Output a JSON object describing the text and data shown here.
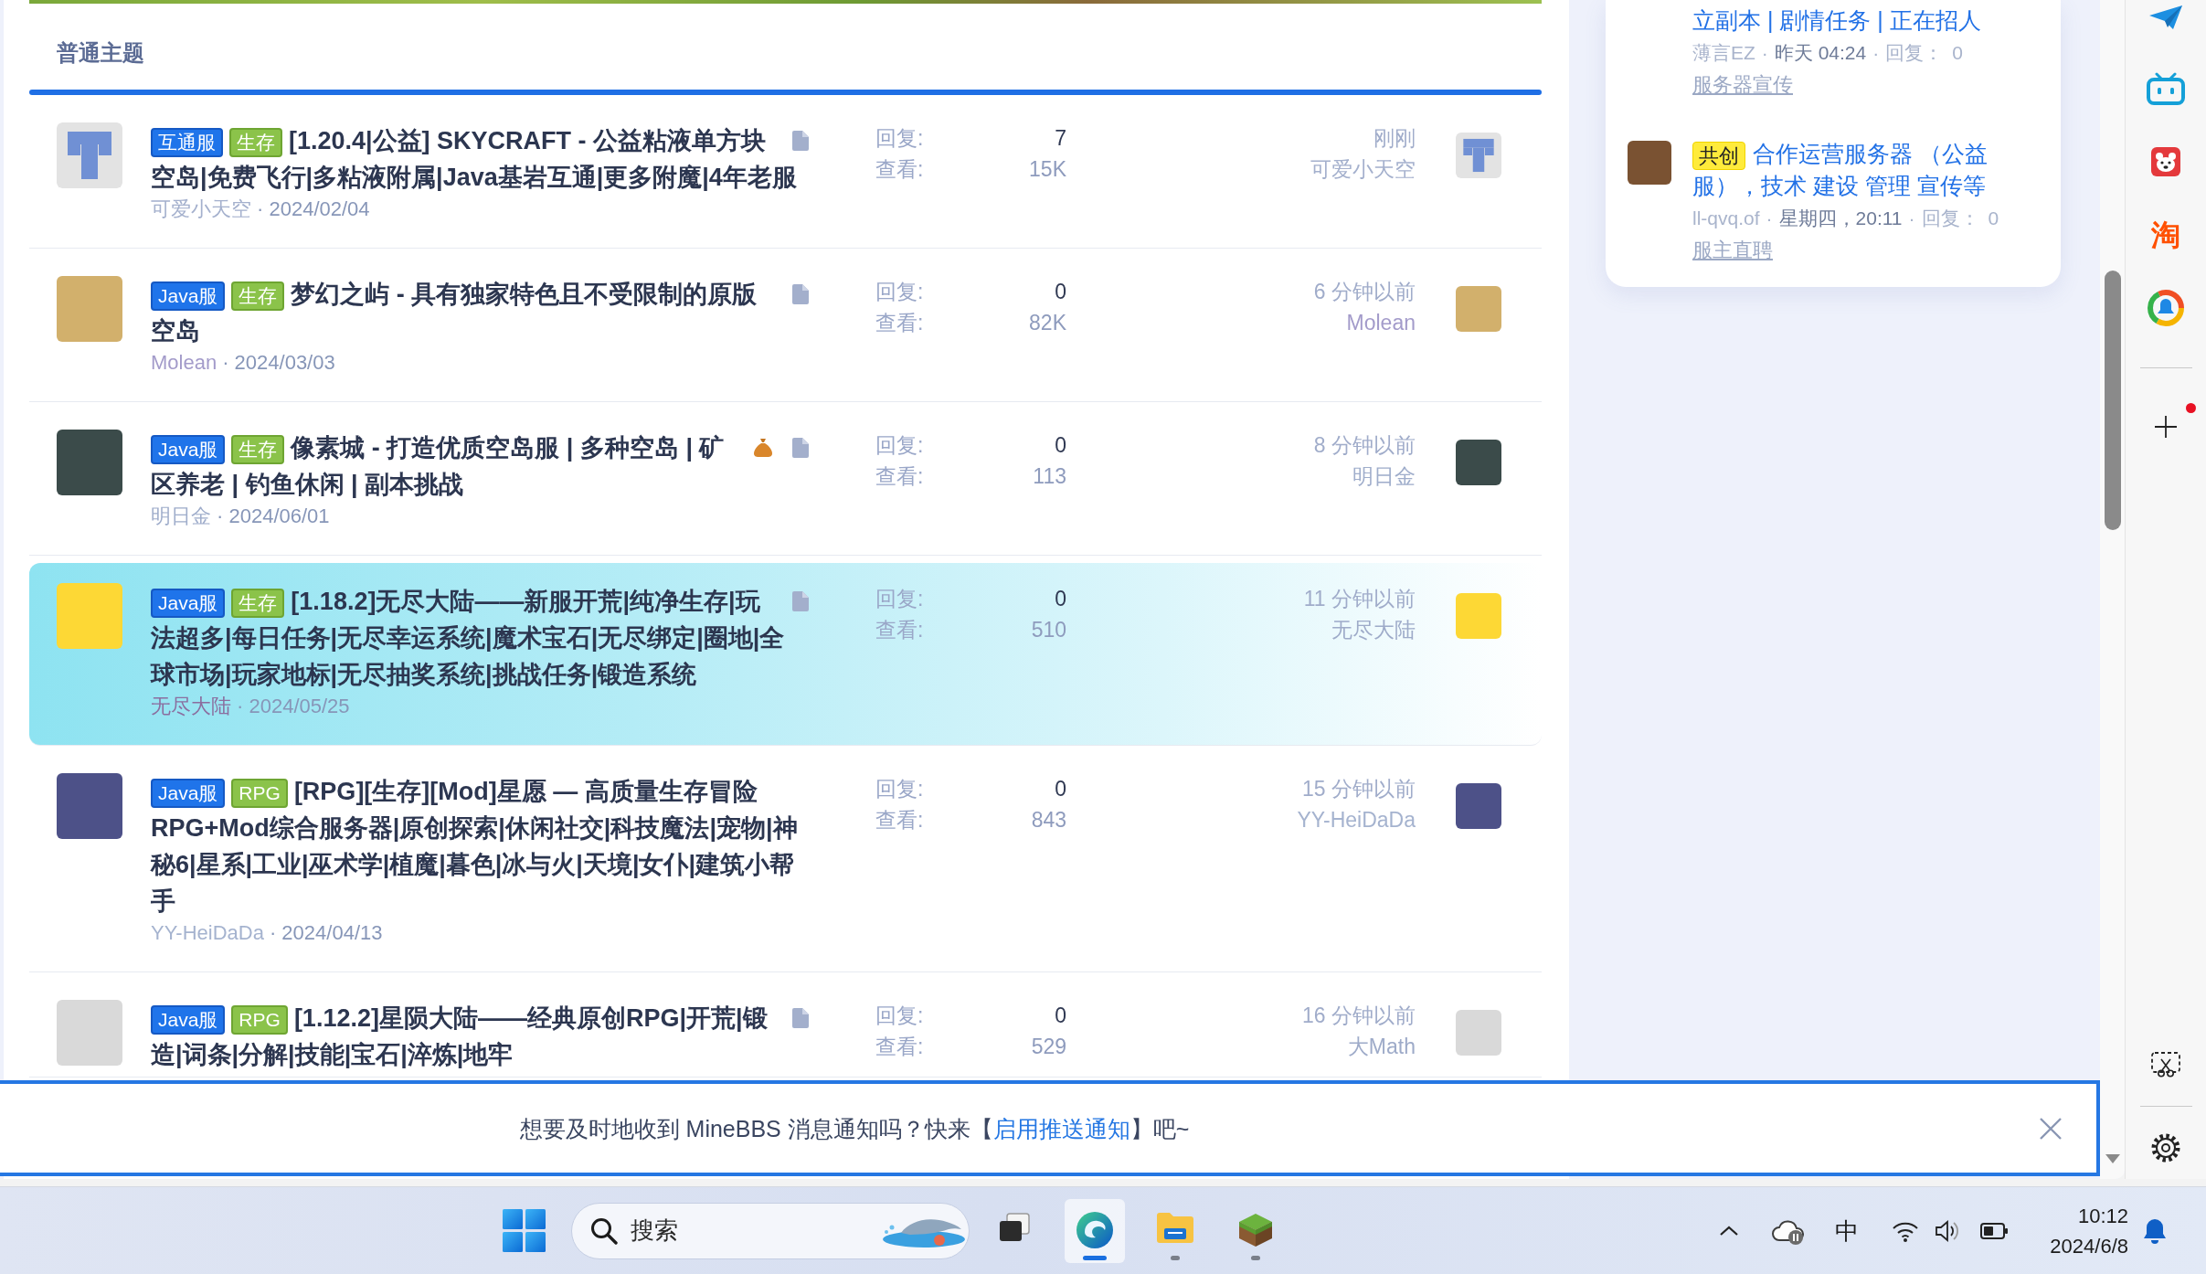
{
  "forum": {
    "section_title": "普通主题",
    "threads": [
      {
        "highlighted": false,
        "avatar": {
          "kind": "pattern",
          "color": "#7090d4"
        },
        "tags": [
          {
            "label": "互通服",
            "kind": "platform"
          },
          {
            "label": "生存",
            "kind": "genre"
          }
        ],
        "title": "[1.20.4|公益] SKYCRAFT - 公益粘液单方块空岛|免费飞行|多粘液附属|Java基岩互通|更多附魔|4年老服",
        "reward": false,
        "attachment": true,
        "author": {
          "name": "可爱小天空",
          "color": "#a4b0cd"
        },
        "date": "· 2024/02/04",
        "stats": [
          {
            "kind": "replies",
            "label": "回复:",
            "value": "7"
          },
          {
            "kind": "views",
            "label": "查看:",
            "value": "15K"
          }
        ],
        "last_post": {
          "time": "刚刚",
          "user": {
            "name": "可爱小天空",
            "color": "#a4b0cd"
          },
          "avatar": {
            "kind": "pattern",
            "color": "#7090d4"
          }
        }
      },
      {
        "highlighted": false,
        "avatar": {
          "kind": "image",
          "color": "#d2b06c"
        },
        "tags": [
          {
            "label": "Java服",
            "kind": "platform"
          },
          {
            "label": "生存",
            "kind": "genre"
          }
        ],
        "title": "梦幻之屿 - 具有独家特色且不受限制的原版空岛",
        "reward": false,
        "attachment": true,
        "author": {
          "name": "Molean",
          "color": "#a39bca"
        },
        "date": "· 2024/03/03",
        "stats": [
          {
            "kind": "replies",
            "label": "回复:",
            "value": "0"
          },
          {
            "kind": "views",
            "label": "查看:",
            "value": "82K"
          }
        ],
        "last_post": {
          "time": "6 分钟以前",
          "user": {
            "name": "Molean",
            "color": "#a39bca"
          },
          "avatar": {
            "kind": "image",
            "color": "#d2b06c"
          }
        }
      },
      {
        "highlighted": false,
        "avatar": {
          "kind": "image",
          "color": "#3b4b4a"
        },
        "tags": [
          {
            "label": "Java服",
            "kind": "platform"
          },
          {
            "label": "生存",
            "kind": "genre"
          }
        ],
        "title": "像素城 - 打造优质空岛服 | 多种空岛 | 矿区养老 | 钓鱼休闲 | 副本挑战",
        "reward": true,
        "attachment": true,
        "author": {
          "name": "明日金",
          "color": "#9fadcb"
        },
        "date": "· 2024/06/01",
        "stats": [
          {
            "kind": "replies",
            "label": "回复:",
            "value": "0"
          },
          {
            "kind": "views",
            "label": "查看:",
            "value": "113"
          }
        ],
        "last_post": {
          "time": "8 分钟以前",
          "user": {
            "name": "明日金",
            "color": "#9fadcb"
          },
          "avatar": {
            "kind": "image",
            "color": "#3b4b4a"
          }
        }
      },
      {
        "highlighted": true,
        "avatar": {
          "kind": "image",
          "color": "#fdd835"
        },
        "tags": [
          {
            "label": "Java服",
            "kind": "platform"
          },
          {
            "label": "生存",
            "kind": "genre"
          }
        ],
        "title": "[1.18.2]无尽大陆——新服开荒|纯净生存|玩法超多|每日任务|无尽幸运系统|魔术宝石|无尽绑定|圈地|全球市场|玩家地标|无尽抽奖系统|挑战任务|锻造系统",
        "reward": false,
        "attachment": true,
        "author": {
          "name": "无尽大陆",
          "color": "#8b6e9f"
        },
        "date": "· 2024/05/25",
        "stats": [
          {
            "kind": "replies",
            "label": "回复:",
            "value": "0"
          },
          {
            "kind": "views",
            "label": "查看:",
            "value": "510"
          }
        ],
        "last_post": {
          "time": "11 分钟以前",
          "user": {
            "name": "无尽大陆",
            "color": "#9eabc9"
          },
          "avatar": {
            "kind": "image",
            "color": "#fdd835"
          }
        }
      },
      {
        "highlighted": false,
        "avatar": {
          "kind": "image",
          "color": "#4d5188"
        },
        "tags": [
          {
            "label": "Java服",
            "kind": "platform"
          },
          {
            "label": "RPG",
            "kind": "genre"
          }
        ],
        "title": "[RPG][生存][Mod]星愿 — 高质量生存冒险RPG+Mod综合服务器|原创探索|休闲社交|科技魔法|宠物|神秘6|星系|工业|巫术学|植魔|暮色|冰与火|天境|女仆|建筑小帮手",
        "reward": false,
        "attachment": false,
        "author": {
          "name": "YY-HeiDaDa",
          "color": "#a5b3cf"
        },
        "date": "· 2024/04/13",
        "stats": [
          {
            "kind": "replies",
            "label": "回复:",
            "value": "0"
          },
          {
            "kind": "views",
            "label": "查看:",
            "value": "843"
          }
        ],
        "last_post": {
          "time": "15 分钟以前",
          "user": {
            "name": "YY-HeiDaDa",
            "color": "#a5b3cf"
          },
          "avatar": {
            "kind": "image",
            "color": "#4d5188"
          }
        }
      },
      {
        "highlighted": false,
        "avatar": {
          "kind": "image",
          "color": "#d9d9d9"
        },
        "tags": [
          {
            "label": "Java服",
            "kind": "platform"
          },
          {
            "label": "RPG",
            "kind": "genre"
          }
        ],
        "title": "[1.12.2]星陨大陆——经典原创RPG|开荒|锻造|词条|分解|技能|宝石|淬炼|地牢",
        "reward": false,
        "attachment": true,
        "stats": [
          {
            "kind": "replies",
            "label": "回复:",
            "value": "0"
          },
          {
            "kind": "views",
            "label": "查看:",
            "value": "529"
          }
        ],
        "last_post": {
          "time": "16 分钟以前",
          "user": {
            "name": "大Math",
            "color": "#9eabc9"
          },
          "avatar": {
            "kind": "image",
            "color": "#d9d9d9"
          }
        }
      }
    ]
  },
  "sidebar": {
    "items": [
      {
        "title": "立副本 | 剧情任务 | 正在招人",
        "meta": [
          {
            "kind": "user",
            "text": "薄言EZ"
          },
          {
            "kind": "separator",
            "text": "·"
          },
          {
            "kind": "time",
            "text": "昨天 04:24"
          },
          {
            "kind": "separator",
            "text": "·"
          },
          {
            "kind": "label",
            "text": "回复："
          },
          {
            "kind": "count",
            "text": "0"
          }
        ],
        "forum": "服务器宣传"
      },
      {
        "avatar": {
          "kind": "image",
          "color": "#7a5232"
        },
        "tag": {
          "label": "共创",
          "kind": "featured"
        },
        "title": "合作运营服务器 （公益服），技术 建设 管理 宣传等",
        "meta": [
          {
            "kind": "user",
            "text": "ll-qvq.of"
          },
          {
            "kind": "separator",
            "text": "·"
          },
          {
            "kind": "time",
            "text": "星期四，20:11"
          },
          {
            "kind": "separator",
            "text": "·"
          },
          {
            "kind": "label",
            "text": "回复："
          },
          {
            "kind": "count",
            "text": "0"
          }
        ],
        "forum": "服主直聘"
      }
    ]
  },
  "notification": {
    "text_before": "想要及时地收到 MineBBS 消息通知吗？快来【",
    "link": "启用推送通知",
    "text_after": "】吧~"
  },
  "browser_sidebar": {
    "app_glyph": "淘",
    "notification_dot": true
  },
  "taskbar": {
    "search": {
      "placeholder": "搜索"
    },
    "apps": [
      {
        "kind": "task-view",
        "active": false,
        "running": false
      },
      {
        "kind": "browser",
        "active": true,
        "running": true
      },
      {
        "kind": "files",
        "active": false,
        "running": true
      },
      {
        "kind": "game",
        "active": false,
        "running": true
      }
    ],
    "tray": {
      "input_method": "中",
      "time": "10:12",
      "date": "2024/6/8"
    }
  }
}
